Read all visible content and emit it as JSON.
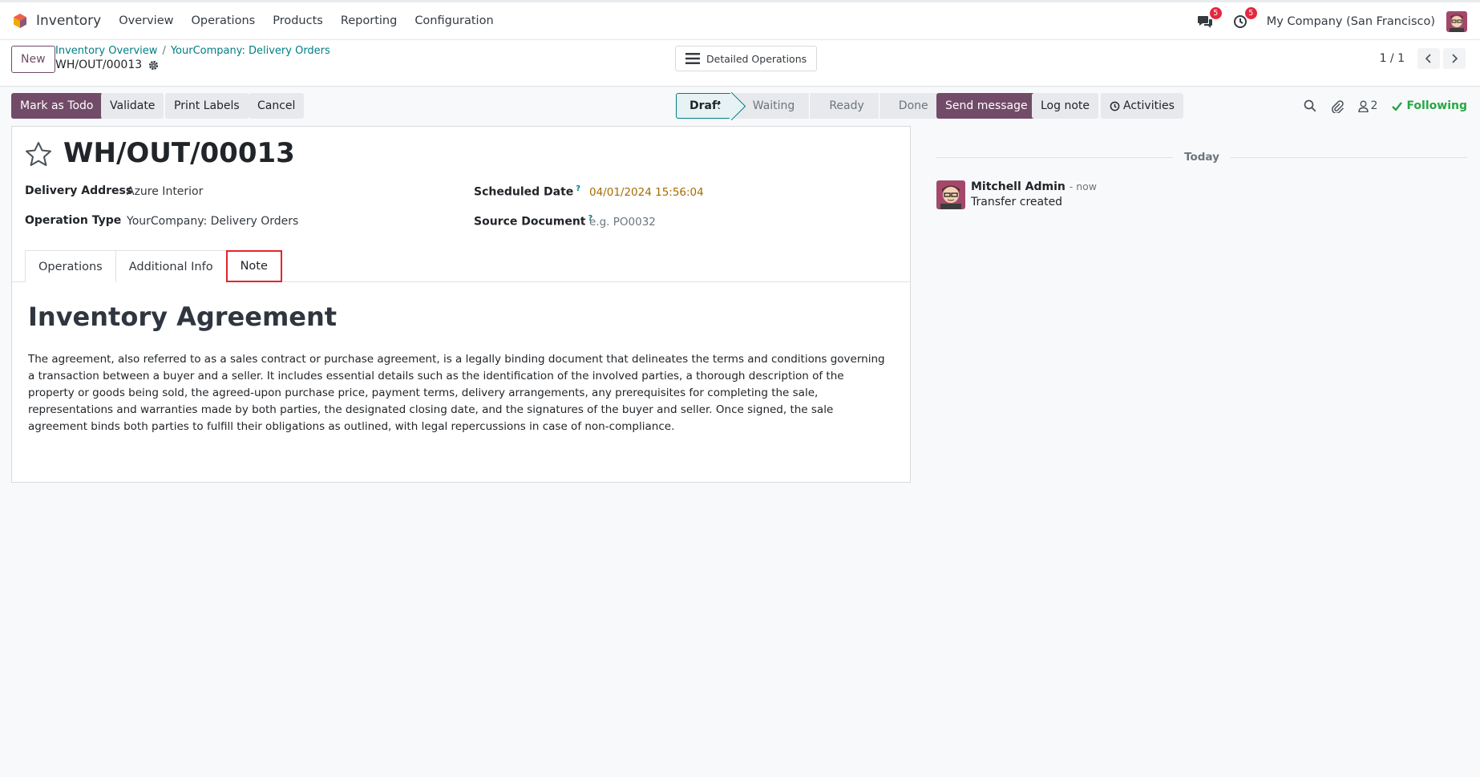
{
  "navbar": {
    "app_name": "Inventory",
    "menu": [
      "Overview",
      "Operations",
      "Products",
      "Reporting",
      "Configuration"
    ],
    "messages_badge": "5",
    "activities_badge": "5",
    "company": "My Company (San Francisco)"
  },
  "control": {
    "new_label": "New",
    "breadcrumb": [
      "Inventory Overview",
      "YourCompany: Delivery Orders"
    ],
    "breadcrumb_sep": "/",
    "current": "WH/OUT/00013",
    "detailed_operations_label": "Detailed Operations",
    "pager_value": "1 / 1"
  },
  "actions": {
    "mark_todo": "Mark as Todo",
    "validate": "Validate",
    "print_labels": "Print Labels",
    "cancel": "Cancel"
  },
  "statusbar": {
    "stages": [
      "Draft",
      "Waiting",
      "Ready",
      "Done"
    ],
    "active": "Draft"
  },
  "form": {
    "reference": "WH/OUT/00013",
    "delivery_address_label": "Delivery Address",
    "delivery_address": "Azure Interior",
    "operation_type_label": "Operation Type",
    "operation_type": "YourCompany: Delivery Orders",
    "scheduled_date_label": "Scheduled Date",
    "scheduled_date": "04/01/2024 15:56:04",
    "source_document_label": "Source Document",
    "source_document_placeholder": "e.g. PO0032",
    "help_mark": "?",
    "tabs": [
      "Operations",
      "Additional Info",
      "Note"
    ],
    "active_tab": "Note"
  },
  "note": {
    "title": "Inventory Agreement",
    "body": "The agreement, also referred to as a sales contract or purchase agreement, is a legally binding document that delineates the terms and conditions governing a transaction between a buyer and a seller. It includes essential details such as the identification of the involved parties, a thorough description of the property or goods being sold, the agreed-upon purchase price, payment terms, delivery arrangements, any prerequisites for completing the sale, representations and warranties made by both parties, the designated closing date, and the signatures of the buyer and seller. Once signed, the sale agreement binds both parties to fulfill their obligations as outlined, with legal repercussions in case of non-compliance."
  },
  "chatter": {
    "send_message": "Send message",
    "log_note": "Log note",
    "activities": "Activities",
    "followers_count": "2",
    "following": "Following",
    "date_separator": "Today",
    "messages": [
      {
        "author": "Mitchell Admin",
        "time": "- now",
        "text": "Transfer created"
      }
    ]
  },
  "colors": {
    "primary": "#714b67",
    "link": "#017e84",
    "following": "#28a745",
    "badge": "#e6273e",
    "highlight": "#e5232b"
  }
}
